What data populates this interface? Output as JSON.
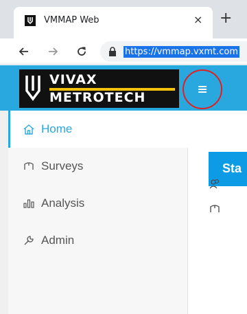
{
  "browser": {
    "tab": {
      "title": "VMMAP Web",
      "close_glyph": "×"
    },
    "new_tab_glyph": "+",
    "url": "https://vmmap.vxmt.com",
    "icons": [
      "app-favicon",
      "arrow-left-icon",
      "arrow-right-icon",
      "reload-icon",
      "lock-icon"
    ]
  },
  "app": {
    "header_color": "#29a8e0",
    "accent_color": "#0d9be6",
    "logo": {
      "line1": "VIVAX",
      "line2": "METROTECH",
      "bar_color": "#f4c20d"
    },
    "menu_toggle": {
      "icon": "hamburger-icon",
      "highlight_color": "#e0201f"
    }
  },
  "sidebar": {
    "items": [
      {
        "label": "Home",
        "icon": "home-icon",
        "active": true
      },
      {
        "label": "Surveys",
        "icon": "survey-icon",
        "active": false
      },
      {
        "label": "Analysis",
        "icon": "chart-icon",
        "active": false
      },
      {
        "label": "Admin",
        "icon": "wrench-icon",
        "active": false
      }
    ]
  },
  "main": {
    "status_title": "Sta",
    "row_icons": [
      "users-icon",
      "survey-icon"
    ]
  }
}
